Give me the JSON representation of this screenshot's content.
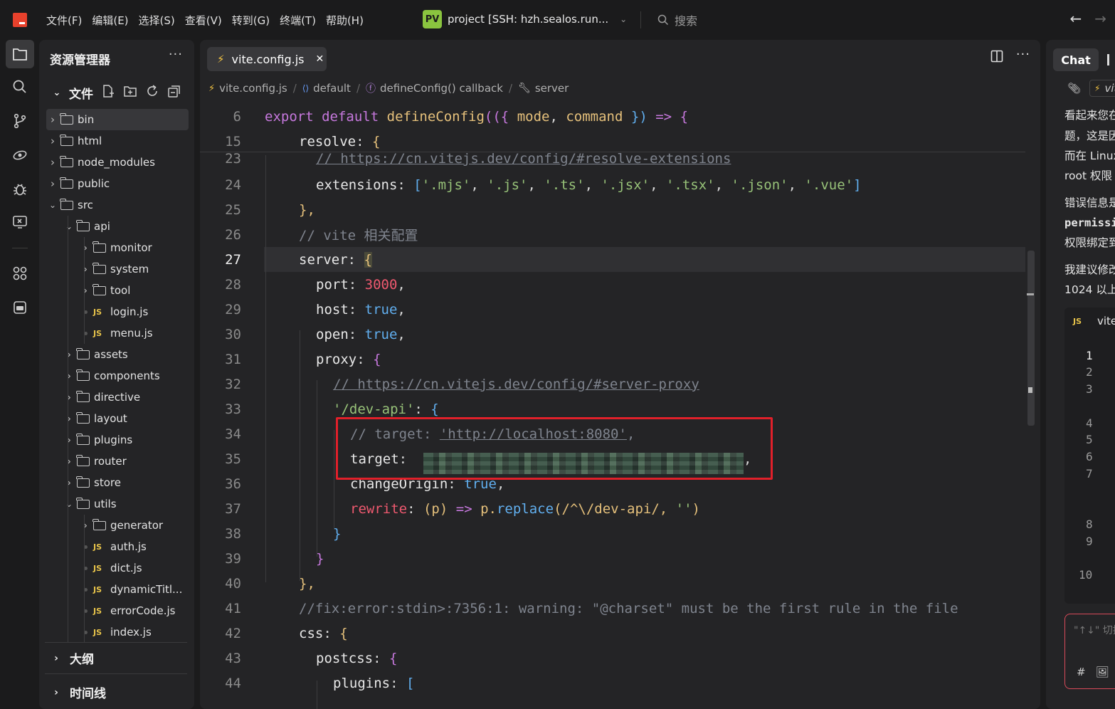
{
  "menu": [
    "文件(F)",
    "编辑(E)",
    "选择(S)",
    "查看(V)",
    "转到(G)",
    "终端(T)",
    "帮助(H)"
  ],
  "project": {
    "badge": "PV",
    "title": "project [SSH: hzh.sealos.run..."
  },
  "search": {
    "placeholder": "搜索"
  },
  "sidebar": {
    "title": "资源管理器",
    "files_label": "文件",
    "outline_label": "大纲",
    "timeline_label": "时间线",
    "tree": [
      {
        "label": "bin",
        "type": "folder",
        "depth": 0,
        "open": false
      },
      {
        "label": "html",
        "type": "folder",
        "depth": 0,
        "open": false
      },
      {
        "label": "node_modules",
        "type": "folder",
        "depth": 0,
        "open": false
      },
      {
        "label": "public",
        "type": "folder",
        "depth": 0,
        "open": false
      },
      {
        "label": "src",
        "type": "folder",
        "depth": 0,
        "open": true
      },
      {
        "label": "api",
        "type": "folder",
        "depth": 1,
        "open": true
      },
      {
        "label": "monitor",
        "type": "folder",
        "depth": 2,
        "open": false
      },
      {
        "label": "system",
        "type": "folder",
        "depth": 2,
        "open": false
      },
      {
        "label": "tool",
        "type": "folder",
        "depth": 2,
        "open": false
      },
      {
        "label": "login.js",
        "type": "js",
        "depth": 2
      },
      {
        "label": "menu.js",
        "type": "js",
        "depth": 2
      },
      {
        "label": "assets",
        "type": "folder",
        "depth": 1,
        "open": false
      },
      {
        "label": "components",
        "type": "folder",
        "depth": 1,
        "open": false
      },
      {
        "label": "directive",
        "type": "folder",
        "depth": 1,
        "open": false
      },
      {
        "label": "layout",
        "type": "folder",
        "depth": 1,
        "open": false
      },
      {
        "label": "plugins",
        "type": "folder",
        "depth": 1,
        "open": false
      },
      {
        "label": "router",
        "type": "folder",
        "depth": 1,
        "open": false
      },
      {
        "label": "store",
        "type": "folder",
        "depth": 1,
        "open": false
      },
      {
        "label": "utils",
        "type": "folder",
        "depth": 1,
        "open": true
      },
      {
        "label": "generator",
        "type": "folder",
        "depth": 2,
        "open": false
      },
      {
        "label": "auth.js",
        "type": "js",
        "depth": 2
      },
      {
        "label": "dict.js",
        "type": "js",
        "depth": 2
      },
      {
        "label": "dynamicTitl...",
        "type": "js",
        "depth": 2
      },
      {
        "label": "errorCode.js",
        "type": "js",
        "depth": 2
      },
      {
        "label": "index.js",
        "type": "js",
        "depth": 2
      }
    ]
  },
  "editor": {
    "tab": "vite.config.js",
    "breadcrumb": [
      "vite.config.js",
      "default",
      "defineConfig() callback",
      "server"
    ],
    "current_line": "27",
    "line_numbers": [
      "6",
      "15",
      "23",
      "24",
      "25",
      "26",
      "27",
      "28",
      "29",
      "30",
      "31",
      "32",
      "33",
      "34",
      "35",
      "36",
      "37",
      "38",
      "39",
      "40",
      "41",
      "42",
      "43",
      "44"
    ],
    "code": {
      "l6": [
        "export",
        "default",
        "defineConfig",
        "(({",
        "mode",
        "command",
        "})",
        "=>",
        "{"
      ],
      "l15": [
        "resolve",
        "{"
      ],
      "l23": "// https://cn.vitejs.dev/config/#resolve-extensions",
      "l24": [
        "extensions",
        "'.mjs'",
        "'.js'",
        "'.ts'",
        "'.jsx'",
        "'.tsx'",
        "'.json'",
        "'.vue'"
      ],
      "l25": "},",
      "l26": "// vite 相关配置",
      "l27": [
        "server",
        "{"
      ],
      "l28": [
        "port",
        "3000"
      ],
      "l29": [
        "host",
        "true"
      ],
      "l30": [
        "open",
        "true"
      ],
      "l31": [
        "proxy",
        "{"
      ],
      "l32": "// https://cn.vitejs.dev/config/#server-proxy",
      "l33": [
        "'/dev-api'",
        "{"
      ],
      "l34": [
        "// target: ",
        "'http://localhost:8080'",
        ","
      ],
      "l35": [
        "target"
      ],
      "l36": [
        "changeOrigin",
        "true"
      ],
      "l37": [
        "rewrite",
        "(p)",
        "=>",
        "p.",
        "replace",
        "(/^\\/dev-api/, ",
        "''",
        ")"
      ],
      "l38": "}",
      "l39": "}",
      "l40": "},",
      "l41": "//fix:error:stdin>:7356:1: warning: \"@charset\" must be the first rule in the file",
      "l42": [
        "css",
        "{"
      ],
      "l43": [
        "postcss",
        "{"
      ],
      "l44": [
        "plugins",
        "["
      ]
    }
  },
  "chat": {
    "tab": "Chat",
    "context_file": "vit",
    "lines": [
      "看起来您在",
      "题，这是因",
      "而在 Linux",
      "root 权限",
      "错误信息是",
      "permissi",
      "权限绑定到",
      "我建议修改",
      "1024 以上"
    ],
    "code_file": "vite.",
    "code_lines": [
      "1",
      "2",
      "3",
      "4",
      "5",
      "6",
      "7",
      "8",
      "9",
      "10"
    ],
    "input_placeholder": "\"↑↓\" 切换"
  }
}
